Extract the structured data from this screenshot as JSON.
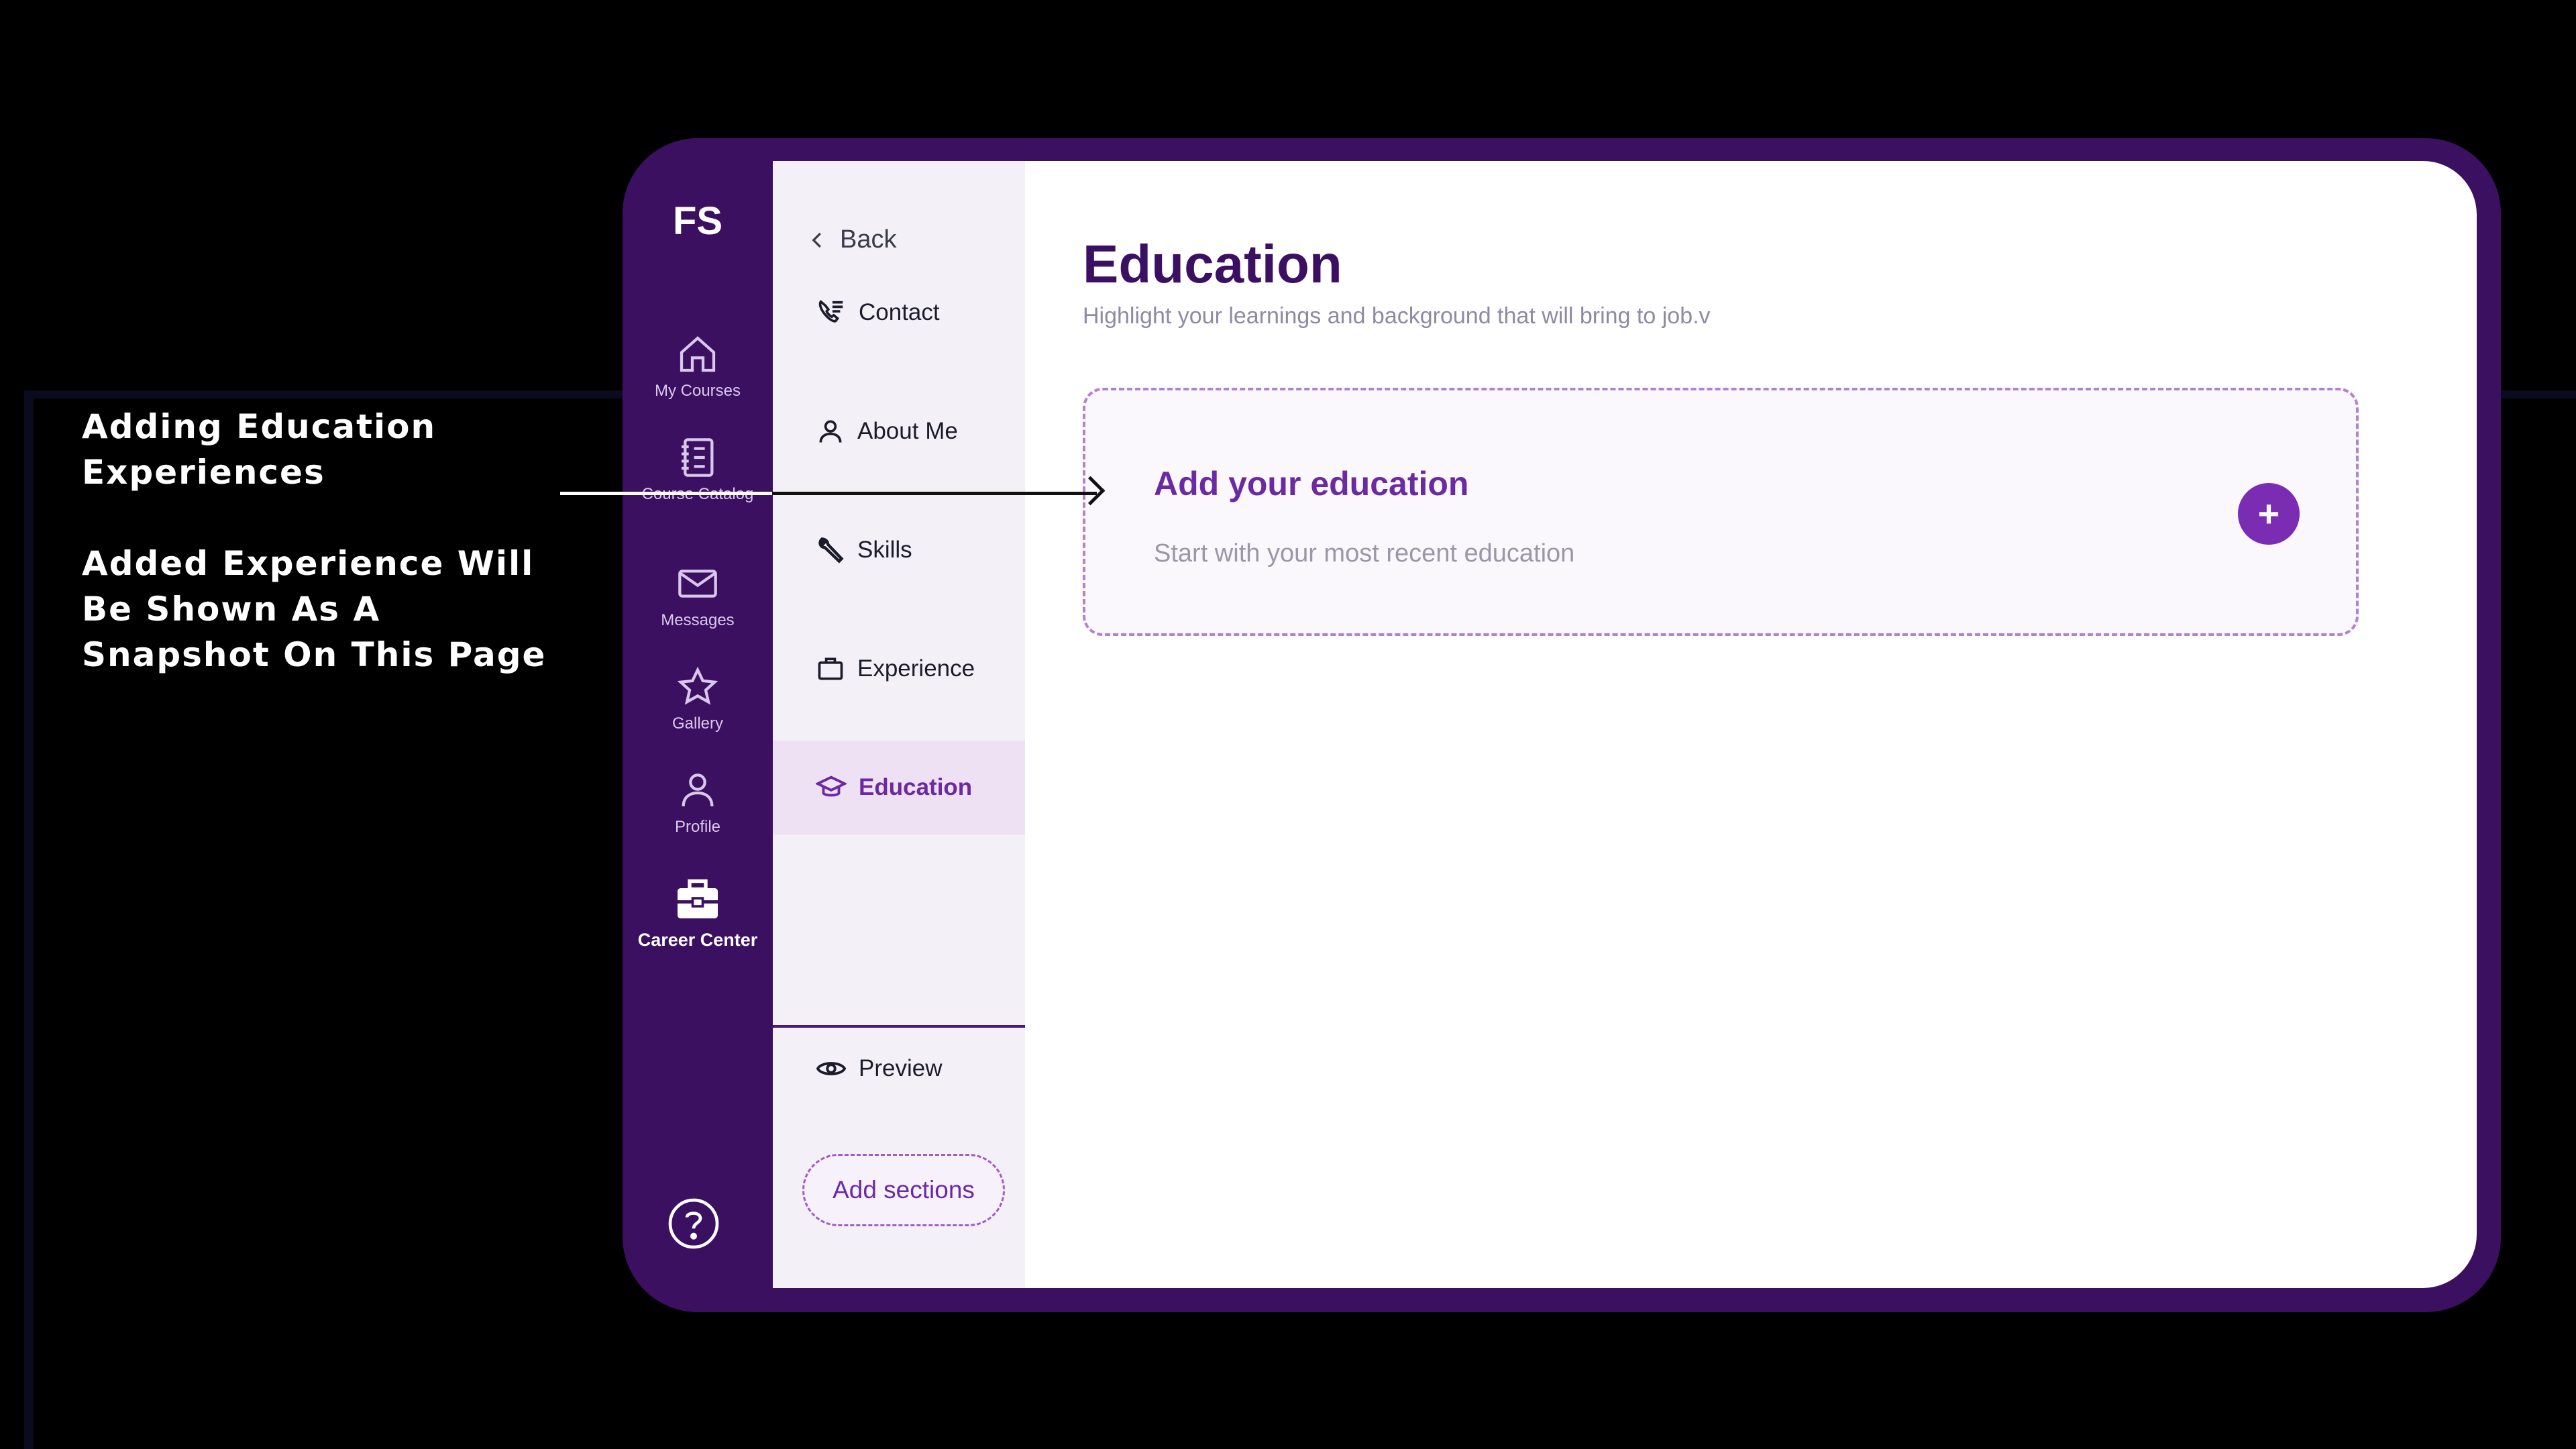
{
  "annotation": {
    "line1": "Adding Education Experiences",
    "line2": "Added Experience Will Be Shown As A Snapshot On This Page"
  },
  "brand": "FS",
  "rail": {
    "items": [
      {
        "label": "My Courses",
        "icon": "home-icon"
      },
      {
        "label": "Course Catalog",
        "icon": "catalog-icon"
      },
      {
        "label": "Messages",
        "icon": "mail-icon"
      },
      {
        "label": "Gallery",
        "icon": "star-icon"
      },
      {
        "label": "Profile",
        "icon": "user-icon"
      },
      {
        "label": "Career Center",
        "icon": "briefcase-icon"
      }
    ],
    "help_icon": "help-icon"
  },
  "sidebar": {
    "back": "Back",
    "items": [
      {
        "label": "Contact",
        "icon": "phone-list-icon"
      },
      {
        "label": "About Me",
        "icon": "user-icon"
      },
      {
        "label": "Skills",
        "icon": "wrench-icon"
      },
      {
        "label": "Experience",
        "icon": "briefcase-icon"
      },
      {
        "label": "Education",
        "icon": "graduation-cap-icon"
      }
    ],
    "preview": "Preview",
    "add_sections": "Add sections"
  },
  "main": {
    "title": "Education",
    "subtitle": "Highlight your learnings and background that will bring to job.v",
    "card": {
      "title": "Add your education",
      "subtitle": "Start with your most recent education",
      "button": "+"
    }
  },
  "colors": {
    "device": "#3b1060",
    "accent": "#7a2db2",
    "title": "#3b0f62",
    "active_bg": "#ede1f3"
  }
}
